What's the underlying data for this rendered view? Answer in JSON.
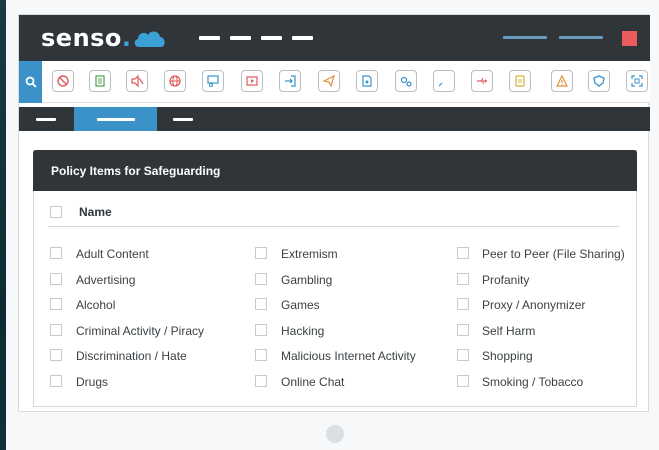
{
  "app": {
    "logo_text": "senso",
    "logo_dot": ".",
    "logo_icon": "cloud-icon"
  },
  "toolbar": {
    "search_icon": "search-icon",
    "icons": [
      {
        "name": "blocked-icon",
        "color": "#e05a5a"
      },
      {
        "name": "document-icon",
        "color": "#5aa85a"
      },
      {
        "name": "muted-icon",
        "color": "#e05a5a"
      },
      {
        "name": "globe-icon",
        "color": "#e05a5a"
      },
      {
        "name": "presentation-icon",
        "color": "#3a92c9"
      },
      {
        "name": "video-icon",
        "color": "#e05a5a"
      },
      {
        "name": "login-icon",
        "color": "#3a92c9"
      },
      {
        "name": "send-icon",
        "color": "#e0903a"
      },
      {
        "name": "file-icon",
        "color": "#3a92c9"
      },
      {
        "name": "gears-icon",
        "color": "#3a92c9"
      },
      {
        "name": "rocket-icon",
        "color": "#3a92c9"
      },
      {
        "name": "usb-icon",
        "color": "#e05a5a"
      },
      {
        "name": "list-icon",
        "color": "#d4b43a"
      },
      {
        "name": "warning-icon",
        "color": "#e0903a"
      },
      {
        "name": "shield-icon",
        "color": "#3a92c9"
      },
      {
        "name": "scan-icon",
        "color": "#3a92c9"
      }
    ]
  },
  "panel": {
    "title": "Policy Items for Safeguarding",
    "column_header": "Name",
    "columns": [
      [
        "Adult Content",
        "Advertising",
        "Alcohol",
        "Criminal Activity / Piracy",
        "Discrimination / Hate",
        "Drugs"
      ],
      [
        "Extremism",
        "Gambling",
        "Games",
        "Hacking",
        "Malicious Internet Activity",
        "Online Chat"
      ],
      [
        "Peer to Peer (File Sharing)",
        "Profanity",
        "Proxy / Anonymizer",
        "Self Harm",
        "Shopping",
        "Smoking / Tobacco"
      ]
    ]
  },
  "colors": {
    "dark": "#2f3538",
    "accent": "#3a92c9",
    "close": "#ea5b5b"
  }
}
